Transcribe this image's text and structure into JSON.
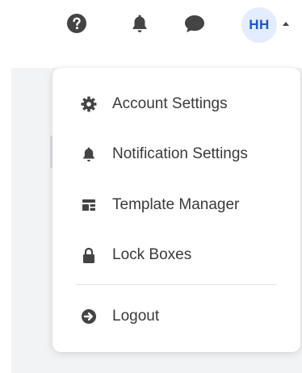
{
  "header": {
    "icons": [
      "question-circle-icon",
      "bell-icon",
      "chat-bubble-icon"
    ],
    "avatar_initials": "HH",
    "avatar_bg": "#e3edff",
    "avatar_text_color": "#1a56db"
  },
  "menu": {
    "items": [
      {
        "label": "Account Settings",
        "icon": "gear-icon"
      },
      {
        "label": "Notification Settings",
        "icon": "bell-icon"
      },
      {
        "label": "Template Manager",
        "icon": "template-icon"
      },
      {
        "label": "Lock Boxes",
        "icon": "lock-icon"
      },
      {
        "label": "Logout",
        "icon": "logout-icon"
      }
    ]
  },
  "colors": {
    "icon": "#444444",
    "text": "#3a3a3a",
    "backdrop": "#f2f3f5"
  }
}
